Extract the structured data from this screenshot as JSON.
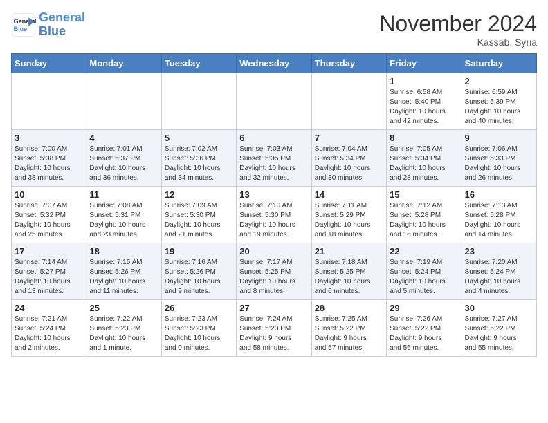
{
  "header": {
    "logo_line1": "General",
    "logo_line2": "Blue",
    "month_title": "November 2024",
    "location": "Kassab, Syria"
  },
  "weekdays": [
    "Sunday",
    "Monday",
    "Tuesday",
    "Wednesday",
    "Thursday",
    "Friday",
    "Saturday"
  ],
  "weeks": [
    [
      {
        "day": "",
        "info": ""
      },
      {
        "day": "",
        "info": ""
      },
      {
        "day": "",
        "info": ""
      },
      {
        "day": "",
        "info": ""
      },
      {
        "day": "",
        "info": ""
      },
      {
        "day": "1",
        "info": "Sunrise: 6:58 AM\nSunset: 5:40 PM\nDaylight: 10 hours\nand 42 minutes."
      },
      {
        "day": "2",
        "info": "Sunrise: 6:59 AM\nSunset: 5:39 PM\nDaylight: 10 hours\nand 40 minutes."
      }
    ],
    [
      {
        "day": "3",
        "info": "Sunrise: 7:00 AM\nSunset: 5:38 PM\nDaylight: 10 hours\nand 38 minutes."
      },
      {
        "day": "4",
        "info": "Sunrise: 7:01 AM\nSunset: 5:37 PM\nDaylight: 10 hours\nand 36 minutes."
      },
      {
        "day": "5",
        "info": "Sunrise: 7:02 AM\nSunset: 5:36 PM\nDaylight: 10 hours\nand 34 minutes."
      },
      {
        "day": "6",
        "info": "Sunrise: 7:03 AM\nSunset: 5:35 PM\nDaylight: 10 hours\nand 32 minutes."
      },
      {
        "day": "7",
        "info": "Sunrise: 7:04 AM\nSunset: 5:34 PM\nDaylight: 10 hours\nand 30 minutes."
      },
      {
        "day": "8",
        "info": "Sunrise: 7:05 AM\nSunset: 5:34 PM\nDaylight: 10 hours\nand 28 minutes."
      },
      {
        "day": "9",
        "info": "Sunrise: 7:06 AM\nSunset: 5:33 PM\nDaylight: 10 hours\nand 26 minutes."
      }
    ],
    [
      {
        "day": "10",
        "info": "Sunrise: 7:07 AM\nSunset: 5:32 PM\nDaylight: 10 hours\nand 25 minutes."
      },
      {
        "day": "11",
        "info": "Sunrise: 7:08 AM\nSunset: 5:31 PM\nDaylight: 10 hours\nand 23 minutes."
      },
      {
        "day": "12",
        "info": "Sunrise: 7:09 AM\nSunset: 5:30 PM\nDaylight: 10 hours\nand 21 minutes."
      },
      {
        "day": "13",
        "info": "Sunrise: 7:10 AM\nSunset: 5:30 PM\nDaylight: 10 hours\nand 19 minutes."
      },
      {
        "day": "14",
        "info": "Sunrise: 7:11 AM\nSunset: 5:29 PM\nDaylight: 10 hours\nand 18 minutes."
      },
      {
        "day": "15",
        "info": "Sunrise: 7:12 AM\nSunset: 5:28 PM\nDaylight: 10 hours\nand 16 minutes."
      },
      {
        "day": "16",
        "info": "Sunrise: 7:13 AM\nSunset: 5:28 PM\nDaylight: 10 hours\nand 14 minutes."
      }
    ],
    [
      {
        "day": "17",
        "info": "Sunrise: 7:14 AM\nSunset: 5:27 PM\nDaylight: 10 hours\nand 13 minutes."
      },
      {
        "day": "18",
        "info": "Sunrise: 7:15 AM\nSunset: 5:26 PM\nDaylight: 10 hours\nand 11 minutes."
      },
      {
        "day": "19",
        "info": "Sunrise: 7:16 AM\nSunset: 5:26 PM\nDaylight: 10 hours\nand 9 minutes."
      },
      {
        "day": "20",
        "info": "Sunrise: 7:17 AM\nSunset: 5:25 PM\nDaylight: 10 hours\nand 8 minutes."
      },
      {
        "day": "21",
        "info": "Sunrise: 7:18 AM\nSunset: 5:25 PM\nDaylight: 10 hours\nand 6 minutes."
      },
      {
        "day": "22",
        "info": "Sunrise: 7:19 AM\nSunset: 5:24 PM\nDaylight: 10 hours\nand 5 minutes."
      },
      {
        "day": "23",
        "info": "Sunrise: 7:20 AM\nSunset: 5:24 PM\nDaylight: 10 hours\nand 4 minutes."
      }
    ],
    [
      {
        "day": "24",
        "info": "Sunrise: 7:21 AM\nSunset: 5:24 PM\nDaylight: 10 hours\nand 2 minutes."
      },
      {
        "day": "25",
        "info": "Sunrise: 7:22 AM\nSunset: 5:23 PM\nDaylight: 10 hours\nand 1 minute."
      },
      {
        "day": "26",
        "info": "Sunrise: 7:23 AM\nSunset: 5:23 PM\nDaylight: 10 hours\nand 0 minutes."
      },
      {
        "day": "27",
        "info": "Sunrise: 7:24 AM\nSunset: 5:23 PM\nDaylight: 9 hours\nand 58 minutes."
      },
      {
        "day": "28",
        "info": "Sunrise: 7:25 AM\nSunset: 5:22 PM\nDaylight: 9 hours\nand 57 minutes."
      },
      {
        "day": "29",
        "info": "Sunrise: 7:26 AM\nSunset: 5:22 PM\nDaylight: 9 hours\nand 56 minutes."
      },
      {
        "day": "30",
        "info": "Sunrise: 7:27 AM\nSunset: 5:22 PM\nDaylight: 9 hours\nand 55 minutes."
      }
    ]
  ]
}
